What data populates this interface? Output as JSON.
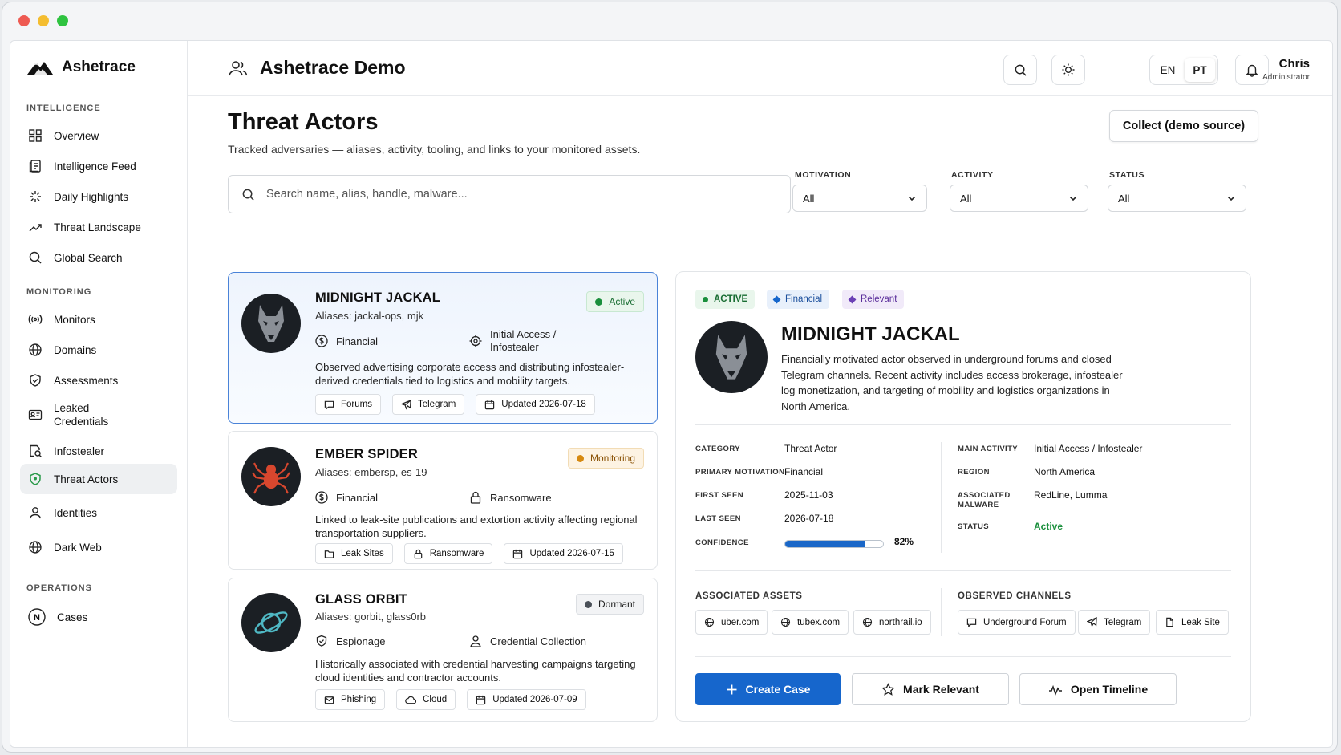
{
  "app": {
    "brand": "Ashetrace",
    "workspace": "Ashetrace Demo"
  },
  "header": {
    "lang_en": "EN",
    "lang_pt": "PT",
    "user_name": "Chris",
    "user_role": "Administrator"
  },
  "sidebar": {
    "sections": [
      "INTELLIGENCE",
      "MONITORING",
      "OPERATIONS"
    ],
    "items": [
      {
        "label": "Overview",
        "icon": "grid-icon"
      },
      {
        "label": "Intelligence Feed",
        "icon": "feed-icon"
      },
      {
        "label": "Daily Highlights",
        "icon": "sparkle-icon"
      },
      {
        "label": "Threat Landscape",
        "icon": "trend-icon"
      },
      {
        "label": "Global Search",
        "icon": "search-icon"
      },
      {
        "label": "Monitors",
        "icon": "radio-icon"
      },
      {
        "label": "Domains",
        "icon": "globe-icon"
      },
      {
        "label": "Assessments",
        "icon": "shield-check-icon"
      },
      {
        "label": "Leaked Credentials",
        "icon": "id-card-icon"
      },
      {
        "label": "Infostealer",
        "icon": "search-bug-icon"
      },
      {
        "label": "Threat Actors",
        "icon": "shield-icon"
      },
      {
        "label": "Identities",
        "icon": "user-icon"
      },
      {
        "label": "Dark Web",
        "icon": "globe-icon"
      },
      {
        "label": "Cases",
        "icon": "n-circle-icon"
      }
    ]
  },
  "page": {
    "title": "Threat Actors",
    "subtitle": "Tracked adversaries — aliases, activity, tooling, and links to your monitored assets.",
    "collect_button": "Collect (demo source)",
    "search_placeholder": "Search name, alias, handle, malware..."
  },
  "filters": [
    {
      "label": "MOTIVATION",
      "value": "All"
    },
    {
      "label": "ACTIVITY",
      "value": "All"
    },
    {
      "label": "STATUS",
      "value": "All"
    }
  ],
  "actors": [
    {
      "name": "MIDNIGHT JACKAL",
      "aliases": "Aliases: jackal-ops, mjk",
      "motivation": "Financial",
      "activity": "Initial Access / Infostealer",
      "status": "Active",
      "status_color": "#1a8f3c",
      "description": "Observed advertising corporate access and distributing infostealer-derived credentials tied to logistics and mobility targets.",
      "tags": [
        "Forums",
        "Telegram",
        "Updated 2026-07-18"
      ]
    },
    {
      "name": "EMBER SPIDER",
      "aliases": "Aliases: embersp, es-19",
      "motivation": "Financial",
      "activity": "Ransomware",
      "status": "Monitoring",
      "status_color": "#c77a0a",
      "description": "Linked to leak-site publications and extortion activity affecting regional transportation suppliers.",
      "tags": [
        "Leak Sites",
        "Ransomware",
        "Updated 2026-07-15"
      ]
    },
    {
      "name": "GLASS ORBIT",
      "aliases": "Aliases: gorbit, glass0rb",
      "motivation": "Espionage",
      "activity": "Credential Collection",
      "status": "Dormant",
      "status_color": "#4a5058",
      "description": "Historically associated with credential harvesting campaigns targeting cloud identities and contractor accounts.",
      "tags": [
        "Phishing",
        "Cloud",
        "Updated 2026-07-09"
      ]
    }
  ],
  "detail": {
    "badges": [
      "ACTIVE",
      "Financial",
      "Relevant"
    ],
    "name": "MIDNIGHT JACKAL",
    "description": "Financially motivated actor observed in underground forums and closed Telegram channels. Recent activity includes access brokerage, infostealer log monetization, and targeting of mobility and logistics organizations in North America.",
    "left_fields": [
      {
        "k": "CATEGORY",
        "v": "Threat Actor"
      },
      {
        "k": "PRIMARY MOTIVATION",
        "v": "Financial"
      },
      {
        "k": "FIRST SEEN",
        "v": "2025-11-03"
      },
      {
        "k": "LAST SEEN",
        "v": "2026-07-18"
      },
      {
        "k": "CONFIDENCE",
        "v": "82%"
      }
    ],
    "confidence": 0.82,
    "right_fields": [
      {
        "k": "MAIN ACTIVITY",
        "v": "Initial Access / Infostealer"
      },
      {
        "k": "REGION",
        "v": "North America"
      },
      {
        "k": "ASSOCIATED MALWARE",
        "v": "RedLine, Lumma"
      },
      {
        "k": "STATUS",
        "v": "Active"
      }
    ],
    "assets_title": "ASSOCIATED ASSETS",
    "assets": [
      "uber.com",
      "tubex.com",
      "northrail.io"
    ],
    "channels_title": "OBSERVED CHANNELS",
    "channels": [
      "Underground Forum",
      "Telegram",
      "Leak Site"
    ],
    "actions": [
      "Create Case",
      "Mark Relevant",
      "Open Timeline"
    ]
  },
  "colors": {
    "accent": "#1666cc",
    "active": "#1a8f3c",
    "monitoring": "#c77a0a",
    "relevant": "#6b3fb5"
  }
}
